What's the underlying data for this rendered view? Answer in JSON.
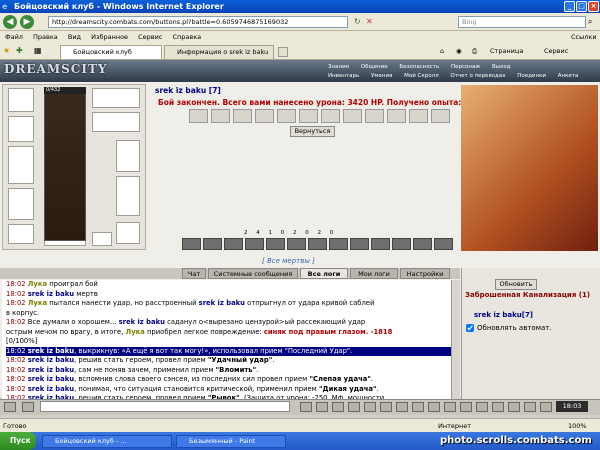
{
  "window": {
    "title": "Бойцовский клуб - Windows Internet Explorer",
    "url": "http://dreamscity.combats.com/buttons.pl?battle=0.6059746875169032",
    "search_placeholder": "Bing"
  },
  "menu": [
    "Файл",
    "Правка",
    "Вид",
    "Избранное",
    "Сервис",
    "Справка"
  ],
  "tabs": [
    {
      "label": "Бойцовский клуб"
    },
    {
      "label": "Информация о srek iz baku"
    }
  ],
  "links_label": "Ссылки",
  "commands": {
    "page": "Страница",
    "tools": "Сервис"
  },
  "game": {
    "logo": "DREAMSCITY",
    "topnav": [
      "Знания",
      "Общение",
      "Безопасность",
      "Персонаж",
      "Выход"
    ],
    "subnav": [
      "Инвентарь",
      "Умения",
      "Мой Скролл",
      "Отчет о переводах",
      "Поединки",
      "Анкета"
    ],
    "hp": "0/432",
    "char_name": "srek iz baku [7]",
    "fight_message": "Бой закончен. Всего вами нанесено урона: 3420 HP. Получено опыта: 0.",
    "return_button": "Вернуться",
    "stats": [
      "2",
      "4",
      "1",
      "0",
      "2",
      "0",
      "2",
      "0"
    ],
    "dead": "[ Все мертвы ]"
  },
  "chat": {
    "tabs": [
      "Чат",
      "Системные сообщения",
      "Все логи",
      "Мои логи",
      "Настройки"
    ],
    "lines": [
      {
        "t": "18:02",
        "parts": [
          {
            "c": "nm2",
            "v": "Лука"
          },
          {
            "c": "",
            "v": " проиграл бой"
          }
        ]
      },
      {
        "t": "18:02",
        "parts": [
          {
            "c": "nm",
            "v": "srek iz baku"
          },
          {
            "c": "",
            "v": " мертв"
          }
        ]
      },
      {
        "t": "18:02",
        "parts": [
          {
            "c": "nm2",
            "v": "Лука"
          },
          {
            "c": "",
            "v": " пытался нанести удар, но расстроенный "
          },
          {
            "c": "nm",
            "v": "srek iz baku"
          },
          {
            "c": "",
            "v": " отпрыгнул от удара кривой саблей"
          }
        ]
      },
      {
        "t": "",
        "parts": [
          {
            "c": "",
            "v": "в корпус."
          }
        ]
      },
      {
        "t": "18:02",
        "parts": [
          {
            "c": "",
            "v": "Все думали о хорошем... "
          },
          {
            "c": "nm",
            "v": "srek iz baku"
          },
          {
            "c": "",
            "v": " саданул о<вырезано цензурой>ый рассекающий удар"
          }
        ]
      },
      {
        "t": "",
        "parts": [
          {
            "c": "",
            "v": "острым мечом по врагу, в итоге, "
          },
          {
            "c": "nm2",
            "v": "Лука"
          },
          {
            "c": "",
            "v": " приобрел легкое повреждение: "
          },
          {
            "c": "red",
            "v": "синяк под правым глазом. -1818"
          }
        ]
      },
      {
        "t": "",
        "parts": [
          {
            "c": "",
            "v": "[0/100%]"
          }
        ]
      },
      {
        "t": "18:02",
        "hl": true,
        "parts": [
          {
            "c": "nm",
            "v": "srek iz baku"
          },
          {
            "c": "",
            "v": ", выкрикнув: «А ещё я вот так могу!», использовал прием \"Последний Удар\"."
          }
        ]
      },
      {
        "t": "18:02",
        "parts": [
          {
            "c": "nm",
            "v": "srek iz baku"
          },
          {
            "c": "",
            "v": ", решив стать героем, провел прием "
          },
          {
            "c": "b",
            "v": "\"Удачный удар\""
          },
          {
            "c": "",
            "v": "."
          }
        ]
      },
      {
        "t": "18:02",
        "parts": [
          {
            "c": "nm",
            "v": "srek iz baku"
          },
          {
            "c": "",
            "v": ", сам не поняв зачем, применил прием "
          },
          {
            "c": "b",
            "v": "\"Вломить\""
          },
          {
            "c": "",
            "v": "."
          }
        ]
      },
      {
        "t": "18:02",
        "parts": [
          {
            "c": "nm",
            "v": "srek iz baku"
          },
          {
            "c": "",
            "v": ", вспомнив слова своего сэнсея, из последних сил провел прием "
          },
          {
            "c": "b",
            "v": "\"Слепая удача\""
          },
          {
            "c": "",
            "v": "."
          }
        ]
      },
      {
        "t": "18:02",
        "parts": [
          {
            "c": "nm",
            "v": "srek iz baku"
          },
          {
            "c": "",
            "v": ", понимая, что ситуация становится критической, применил прием "
          },
          {
            "c": "b",
            "v": "\"Дикая удача\""
          },
          {
            "c": "",
            "v": "."
          }
        ]
      },
      {
        "t": "18:02",
        "parts": [
          {
            "c": "nm",
            "v": "srek iz baku"
          },
          {
            "c": "",
            "v": ", решив стать героем, провел прием "
          },
          {
            "c": "b",
            "v": "\"Рывок\""
          },
          {
            "c": "",
            "v": ". (Защита от урона: -250, Мф. мощности"
          }
        ]
      }
    ]
  },
  "right": {
    "refresh": "Обновить",
    "location": "Заброшенная Канализация (1)",
    "user": "srek iz baku[7]",
    "auto": "Обновлять автомат."
  },
  "clock": "18:03",
  "status": {
    "left": "Готово",
    "zone": "Интернет",
    "zoom": "100%"
  },
  "taskbar": {
    "start": "Пуск",
    "items": [
      "Бойцовский клуб - ...",
      "Безымянный - Paint"
    ]
  },
  "watermark": "photo.scrolls.combats.com"
}
